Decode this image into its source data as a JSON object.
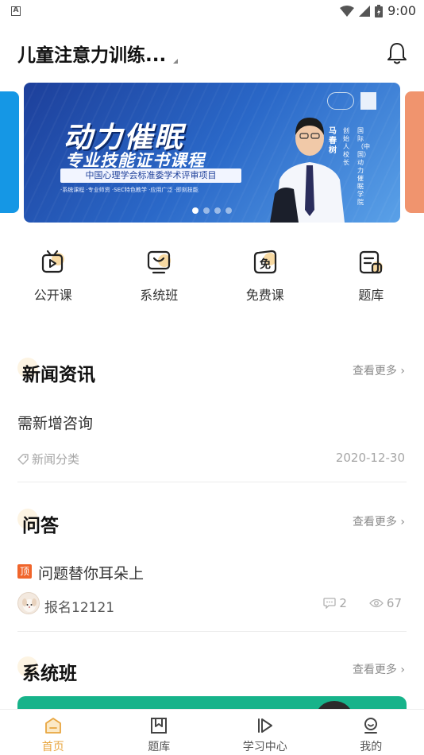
{
  "status_bar": {
    "indicator": "A",
    "time": "9:00"
  },
  "header": {
    "title": "儿童注意力训练..."
  },
  "banner": {
    "title": "动力催眠",
    "subtitle": "专业技能证书课程",
    "strip_text": "中国心理学会标准委学术评审项目",
    "features": "·系统课程 ·专业师资 ·SEC特色教学 ·应用广泛 ·即刻技能",
    "person_name": "马春树",
    "person_role": "创始人 校长",
    "institute": "国际（中国）动力催眠学院",
    "dot_count": 4,
    "active_dot": 0
  },
  "quick_entries": [
    {
      "label": "公开课",
      "icon": "tv-play-icon"
    },
    {
      "label": "系统班",
      "icon": "monitor-icon"
    },
    {
      "label": "免费课",
      "icon": "free-badge-icon"
    },
    {
      "label": "题库",
      "icon": "question-bank-icon"
    }
  ],
  "news": {
    "title": "新闻资讯",
    "more": "查看更多",
    "item": {
      "title": "需新增咨询",
      "category": "新闻分类",
      "date": "2020-12-30"
    }
  },
  "qa": {
    "title": "问答",
    "more": "查看更多",
    "item": {
      "badge": "顶",
      "title": "问题替你耳朵上",
      "user": "报名12121",
      "comments": "2",
      "views": "67"
    }
  },
  "system_class": {
    "title": "系统班",
    "more": "查看更多"
  },
  "bottom_nav": [
    {
      "label": "首页",
      "icon": "home-icon",
      "active": true
    },
    {
      "label": "题库",
      "icon": "bookmark-icon",
      "active": false
    },
    {
      "label": "学习中心",
      "icon": "play-step-icon",
      "active": false
    },
    {
      "label": "我的",
      "icon": "user-icon",
      "active": false
    }
  ],
  "colors": {
    "accent": "#e8a640",
    "banner_blue": "#2a68c8",
    "badge_orange": "#f0652b",
    "course_green": "#17b38a"
  }
}
